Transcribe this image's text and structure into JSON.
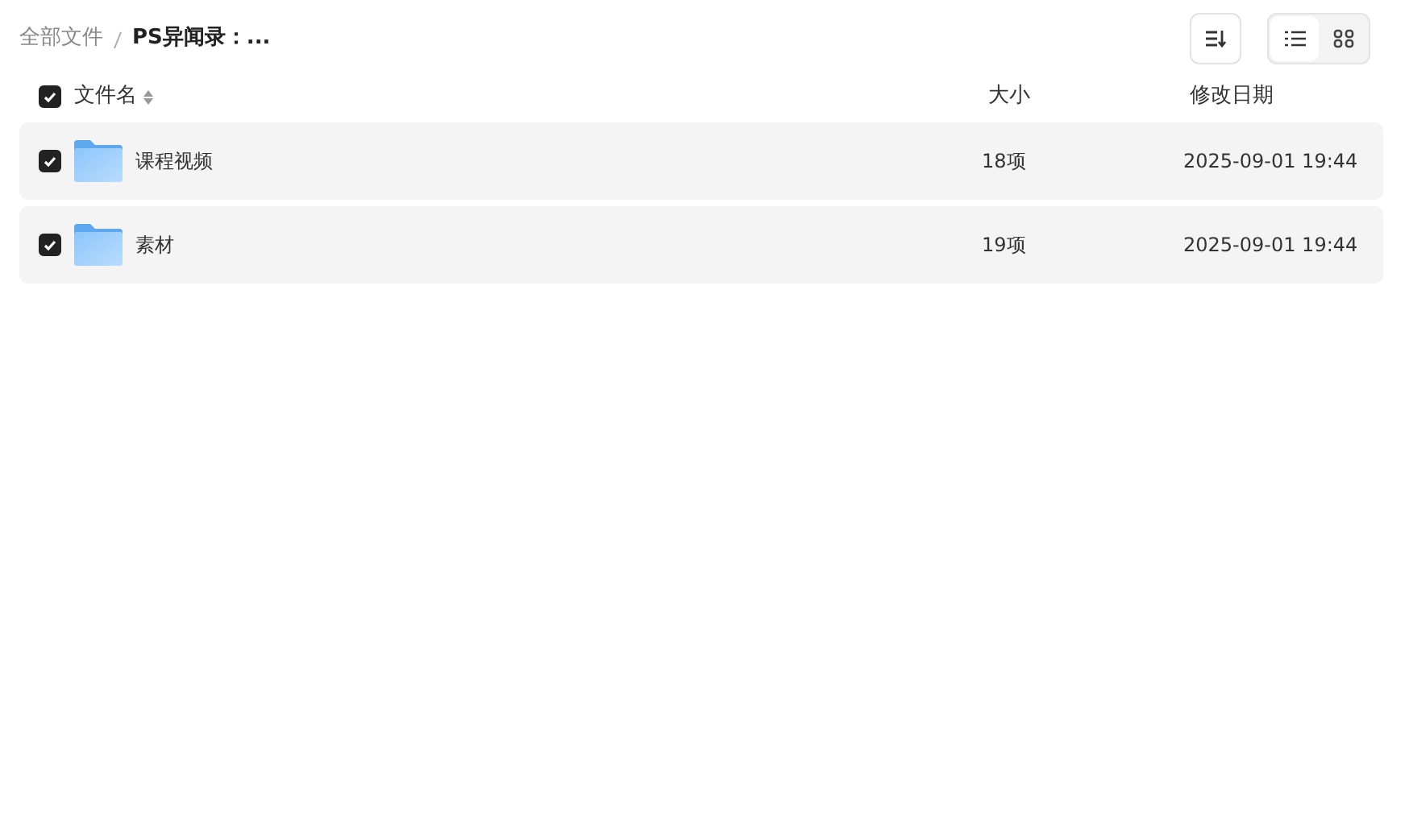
{
  "breadcrumb": [
    {
      "label": "全部文件",
      "current": false
    },
    {
      "label": "PS异闻录：...",
      "current": true
    }
  ],
  "view_modes": [
    {
      "kind": "list",
      "selected": true
    },
    {
      "kind": "grid",
      "selected": false
    }
  ],
  "table": {
    "select_all_checked": true,
    "columns": [
      "文件名",
      "大小",
      "修改日期"
    ],
    "rows": [
      {
        "checked": true,
        "name": "课程视频",
        "size": "18项",
        "modified": "2025-09-01 19:44"
      },
      {
        "checked": true,
        "name": "素材",
        "size": "19项",
        "modified": "2025-09-01 19:44"
      }
    ]
  }
}
